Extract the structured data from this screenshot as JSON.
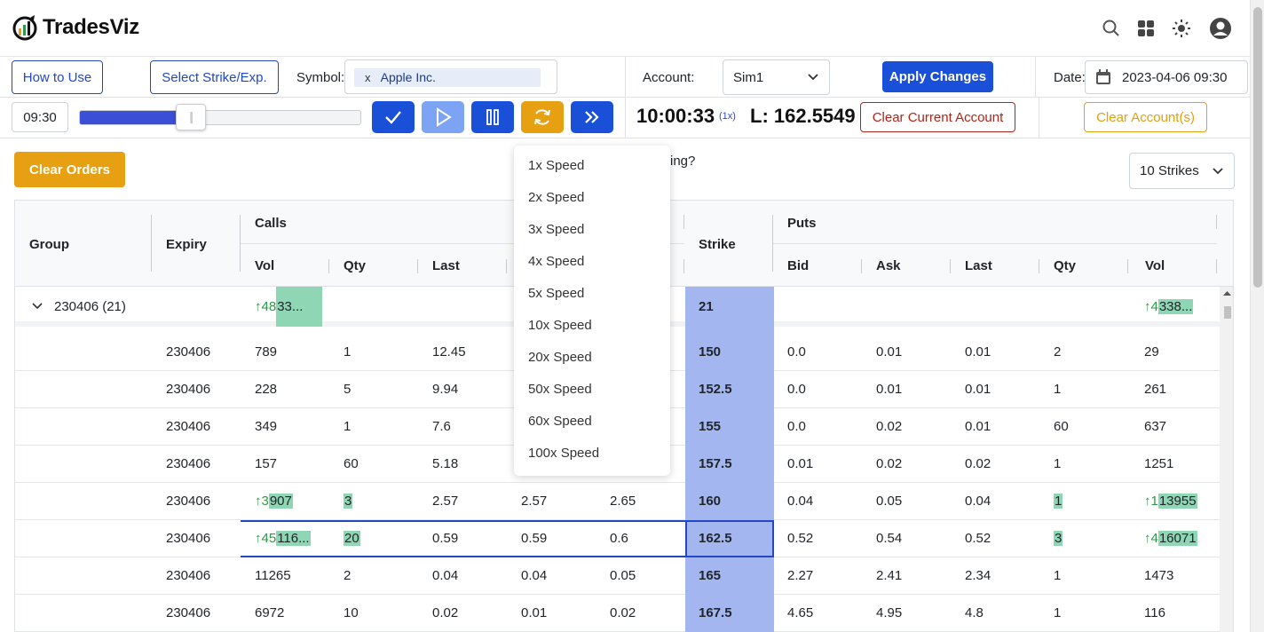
{
  "app": {
    "name": "TradesViz"
  },
  "toolbar": {
    "how_to_use": "How to Use",
    "select_strike": "Select Strike/Exp.",
    "symbol_label": "Symbol:",
    "symbol_chip_x": "x",
    "symbol_value": "Apple Inc.",
    "account_label": "Account:",
    "account_value": "Sim1",
    "apply_changes": "Apply Changes",
    "date_label": "Date:",
    "date_value": "2023-04-06 09:30",
    "start_time": "09:30",
    "progress": 0.36,
    "clock": "10:00:33",
    "speed": "(1x)",
    "last_price": "L: 162.5549",
    "clear_current": "Clear Current Account",
    "clear_accounts": "Clear Account(s)"
  },
  "controls": {
    "clear_orders": "Clear Orders",
    "partial_text": "ing?",
    "strikes_value": "10 Strikes"
  },
  "speed_menu": [
    "1x Speed",
    "2x Speed",
    "3x Speed",
    "4x Speed",
    "5x Speed",
    "10x Speed",
    "20x Speed",
    "50x Speed",
    "60x Speed",
    "100x Speed"
  ],
  "table": {
    "headers": {
      "group": "Group",
      "expiry": "Expiry",
      "calls": "Calls",
      "strike": "Strike",
      "puts": "Puts",
      "call_cols": [
        "Vol",
        "Qty",
        "Last"
      ],
      "put_cols": [
        "Bid",
        "Ask",
        "Last",
        "Qty",
        "Vol"
      ]
    },
    "group_row": {
      "label": "230406 (21)",
      "call_vol_arrow": "↑48",
      "call_vol": "33...",
      "strike": "21",
      "put_vol_arrow": "↑4",
      "put_vol": "338..."
    },
    "rows": [
      {
        "expiry": "230406",
        "c_vol": "789",
        "c_qty": "1",
        "c_last": "12.45",
        "c_bid": "",
        "c_ask": "",
        "strike": "150",
        "p_bid": "0.0",
        "p_ask": "0.01",
        "p_last": "0.01",
        "p_qty": "2",
        "p_vol": "29"
      },
      {
        "expiry": "230406",
        "c_vol": "228",
        "c_qty": "5",
        "c_last": "9.94",
        "c_bid": "",
        "c_ask": "",
        "strike": "152.5",
        "p_bid": "0.0",
        "p_ask": "0.01",
        "p_last": "0.01",
        "p_qty": "1",
        "p_vol": "261"
      },
      {
        "expiry": "230406",
        "c_vol": "349",
        "c_qty": "1",
        "c_last": "7.6",
        "c_bid": "",
        "c_ask": "",
        "strike": "155",
        "p_bid": "0.0",
        "p_ask": "0.02",
        "p_last": "0.01",
        "p_qty": "60",
        "p_vol": "637"
      },
      {
        "expiry": "230406",
        "c_vol": "157",
        "c_qty": "60",
        "c_last": "5.18",
        "c_bid": "",
        "c_ask": "",
        "strike": "157.5",
        "p_bid": "0.01",
        "p_ask": "0.02",
        "p_last": "0.02",
        "p_qty": "1",
        "p_vol": "1251"
      },
      {
        "expiry": "230406",
        "c_vol_arrow": "↑3",
        "c_vol": "907",
        "c_qty": "3",
        "c_last": "2.57",
        "c_bid": "2.57",
        "c_ask": "2.65",
        "strike": "160",
        "p_bid": "0.04",
        "p_ask": "0.05",
        "p_last": "0.04",
        "p_qty": "1",
        "p_vol_arrow": "↑1",
        "p_vol": "13955"
      },
      {
        "expiry": "230406",
        "c_vol_arrow": "↑45",
        "c_vol": "116...",
        "c_qty": "20",
        "c_last": "0.59",
        "c_bid": "0.59",
        "c_ask": "0.6",
        "strike": "162.5",
        "p_bid": "0.52",
        "p_ask": "0.54",
        "p_last": "0.52",
        "p_qty": "3",
        "p_vol_arrow": "↑4",
        "p_vol": "16071"
      },
      {
        "expiry": "230406",
        "c_vol": "11265",
        "c_qty": "2",
        "c_last": "0.04",
        "c_bid": "0.04",
        "c_ask": "0.05",
        "strike": "165",
        "p_bid": "2.27",
        "p_ask": "2.41",
        "p_last": "2.34",
        "p_qty": "1",
        "p_vol": "1473"
      },
      {
        "expiry": "230406",
        "c_vol": "6972",
        "c_qty": "10",
        "c_last": "0.02",
        "c_bid": "0.01",
        "c_ask": "0.02",
        "strike": "167.5",
        "p_bid": "4.65",
        "p_ask": "4.95",
        "p_last": "4.8",
        "p_qty": "1",
        "p_vol": "116"
      }
    ]
  },
  "colors": {
    "primary": "#1a4fd8",
    "warning": "#e8a013",
    "strike_bg": "#a3b6f0",
    "highlight": "#8fd6b5",
    "up": "#2e9a46",
    "danger": "#b42318"
  }
}
